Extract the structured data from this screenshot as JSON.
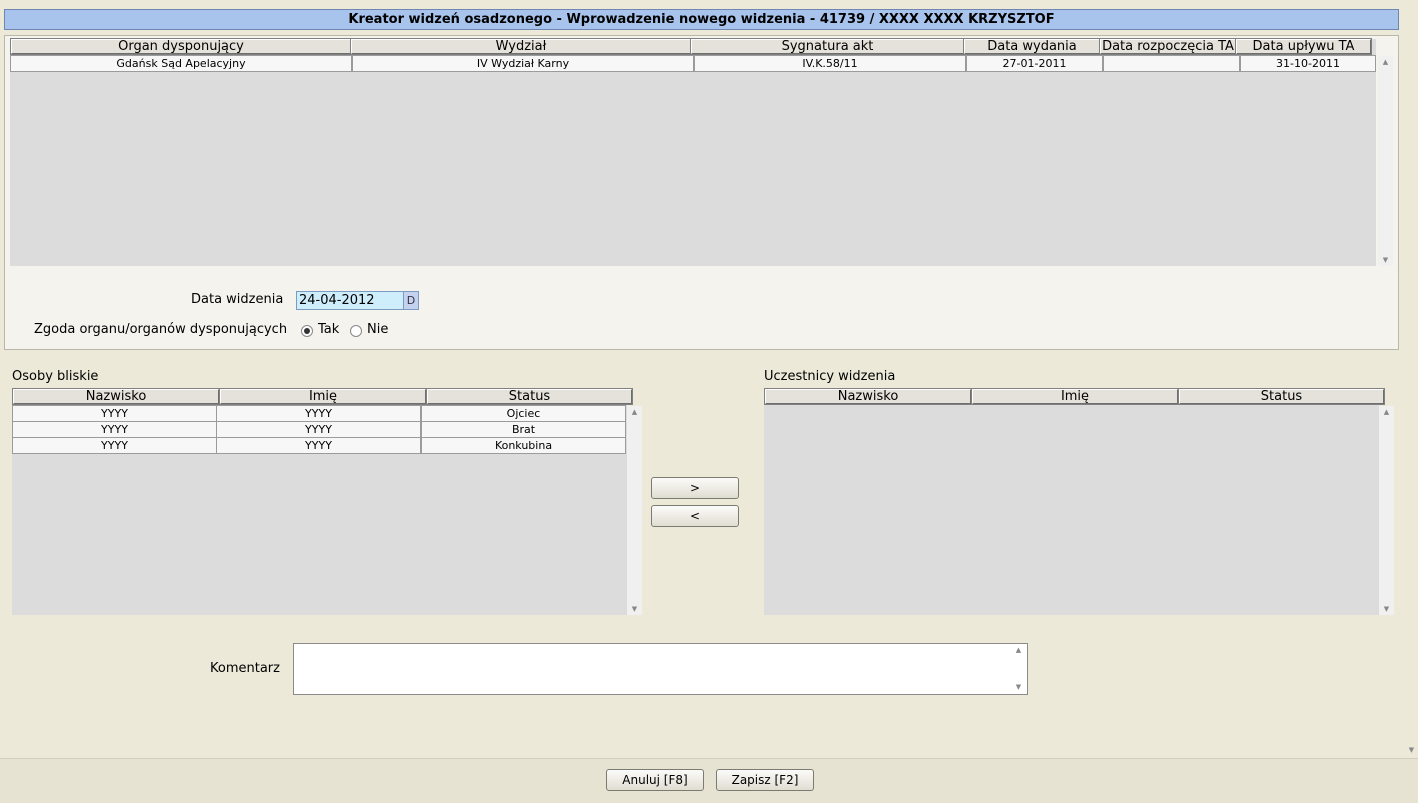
{
  "title": "Kreator widzeń osadzonego - Wprowadzenie nowego widzenia - 41739 / XXXX XXXX KRZYSZTOF",
  "orders_table": {
    "columns": [
      "Organ dysponujący",
      "Wydział",
      "Sygnatura akt",
      "Data wydania",
      "Data rozpoczęcia TA",
      "Data upływu TA"
    ],
    "rows": [
      [
        "Gdańsk Sąd Apelacyjny",
        "IV Wydział Karny",
        "IV.K.58/11",
        "27-01-2011",
        "",
        "31-10-2011"
      ]
    ]
  },
  "form": {
    "date_label": "Data widzenia",
    "date_value": "24-04-2012",
    "date_button": "D",
    "consent_label": "Zgoda organu/organów dysponujących",
    "consent_options": [
      "Tak",
      "Nie"
    ],
    "consent_selected": "Tak"
  },
  "relatives": {
    "label": "Osoby bliskie",
    "columns": [
      "Nazwisko",
      "Imię",
      "Status"
    ],
    "rows": [
      [
        "YYYY",
        "YYYY",
        "Ojciec"
      ],
      [
        "YYYY",
        "YYYY",
        "Brat"
      ],
      [
        "YYYY",
        "YYYY",
        "Konkubina"
      ]
    ]
  },
  "participants": {
    "label": "Uczestnicy widzenia",
    "columns": [
      "Nazwisko",
      "Imię",
      "Status"
    ],
    "rows": []
  },
  "transfer": {
    "add": ">",
    "remove": "<"
  },
  "comment": {
    "label": "Komentarz",
    "value": ""
  },
  "footer": {
    "cancel": "Anuluj [F8]",
    "save": "Zapisz [F2]"
  }
}
